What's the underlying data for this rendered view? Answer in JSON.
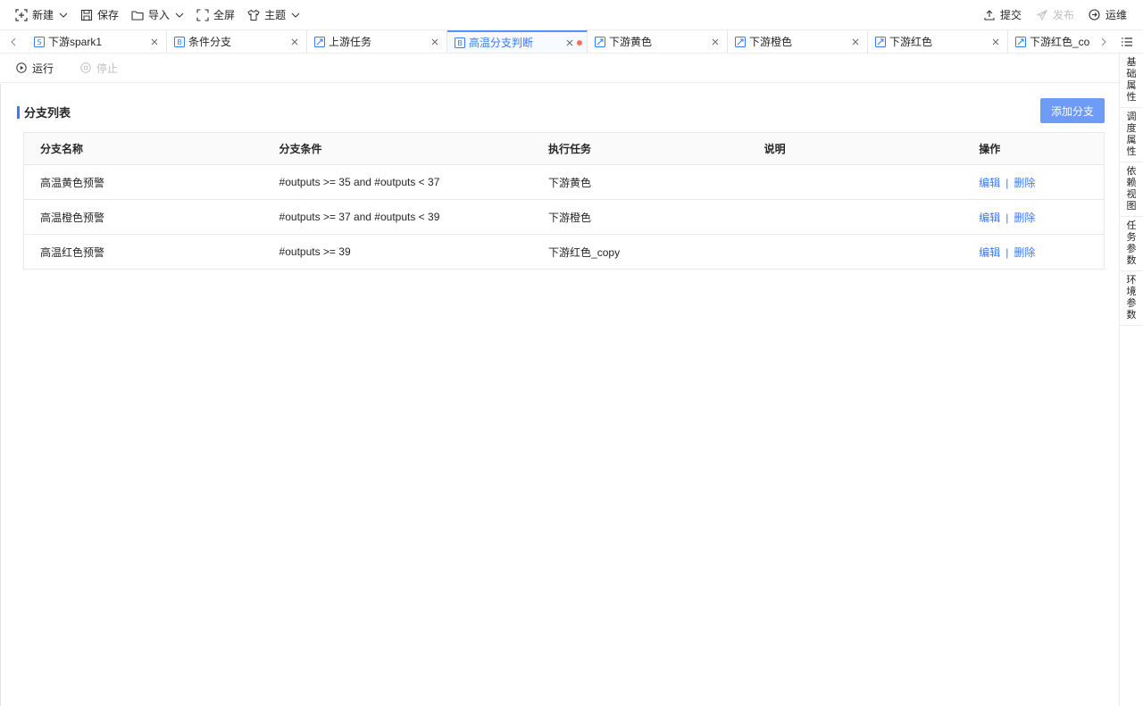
{
  "toolbar": {
    "left": [
      {
        "label": "新建",
        "icon": "new-icon",
        "dropdown": true
      },
      {
        "label": "保存",
        "icon": "save-icon",
        "dropdown": false
      },
      {
        "label": "导入",
        "icon": "folder-icon",
        "dropdown": true
      },
      {
        "label": "全屏",
        "icon": "fullscreen-icon",
        "dropdown": false
      },
      {
        "label": "主题",
        "icon": "theme-icon",
        "dropdown": true
      }
    ],
    "right": [
      {
        "label": "提交",
        "icon": "upload-icon",
        "disabled": false
      },
      {
        "label": "发布",
        "icon": "publish-icon",
        "disabled": true
      },
      {
        "label": "运维",
        "icon": "ops-icon",
        "disabled": false
      }
    ]
  },
  "tabs": [
    {
      "label": "下游spark1",
      "icon": "spark-icon",
      "active": false
    },
    {
      "label": "条件分支",
      "icon": "branch-icon",
      "active": false
    },
    {
      "label": "上游任务",
      "icon": "shell-icon",
      "active": false
    },
    {
      "label": "高温分支判断",
      "icon": "branch-icon",
      "active": true,
      "modified": true
    },
    {
      "label": "下游黄色",
      "icon": "shell-icon",
      "active": false
    },
    {
      "label": "下游橙色",
      "icon": "shell-icon",
      "active": false
    },
    {
      "label": "下游红色",
      "icon": "shell-icon",
      "active": false
    },
    {
      "label": "下游红色_co",
      "icon": "shell-icon",
      "active": false
    }
  ],
  "runbar": {
    "run_label": "运行",
    "stop_label": "停止"
  },
  "side_panel": [
    "基础属性",
    "调度属性",
    "依赖视图",
    "任务参数",
    "环境参数"
  ],
  "section": {
    "title": "分支列表",
    "add_button": "添加分支"
  },
  "table": {
    "headers": [
      "分支名称",
      "分支条件",
      "执行任务",
      "说明",
      "操作"
    ],
    "rows": [
      {
        "name": "高温黄色预警",
        "condition": "#outputs >= 35 and #outputs < 37",
        "task": "下游黄色",
        "desc": "",
        "edit": "编辑",
        "sep": "|",
        "delete": "删除"
      },
      {
        "name": "高温橙色预警",
        "condition": "#outputs >= 37 and #outputs < 39",
        "task": "下游橙色",
        "desc": "",
        "edit": "编辑",
        "sep": "|",
        "delete": "删除"
      },
      {
        "name": "高温红色预警",
        "condition": "#outputs >= 39",
        "task": "下游红色_copy",
        "desc": "",
        "edit": "编辑",
        "sep": "|",
        "delete": "删除"
      }
    ]
  },
  "colors": {
    "accent": "#3b7bf5",
    "button_bg": "#6e9bf5",
    "modified_dot": "#f5735c"
  }
}
